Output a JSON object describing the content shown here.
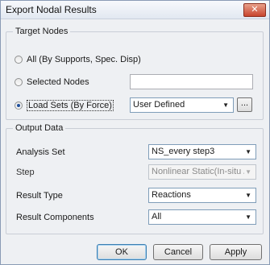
{
  "window": {
    "title": "Export Nodal Results"
  },
  "target_nodes": {
    "legend": "Target Nodes",
    "options": [
      {
        "label": "All (By Supports, Spec. Disp)",
        "checked": false
      },
      {
        "label": "Selected Nodes",
        "checked": false
      },
      {
        "label": "Load Sets (By Force)",
        "checked": true
      }
    ],
    "selected_nodes_value": "",
    "load_set_value": "User Defined",
    "browse_label": "..."
  },
  "output_data": {
    "legend": "Output Data",
    "analysis_set": {
      "label": "Analysis Set",
      "value": "NS_every step3"
    },
    "step": {
      "label": "Step",
      "value": "Nonlinear Static(In-situ /"
    },
    "result_type": {
      "label": "Result Type",
      "value": "Reactions"
    },
    "result_components": {
      "label": "Result Components",
      "value": "All"
    }
  },
  "buttons": {
    "ok": "OK",
    "cancel": "Cancel",
    "apply": "Apply"
  }
}
